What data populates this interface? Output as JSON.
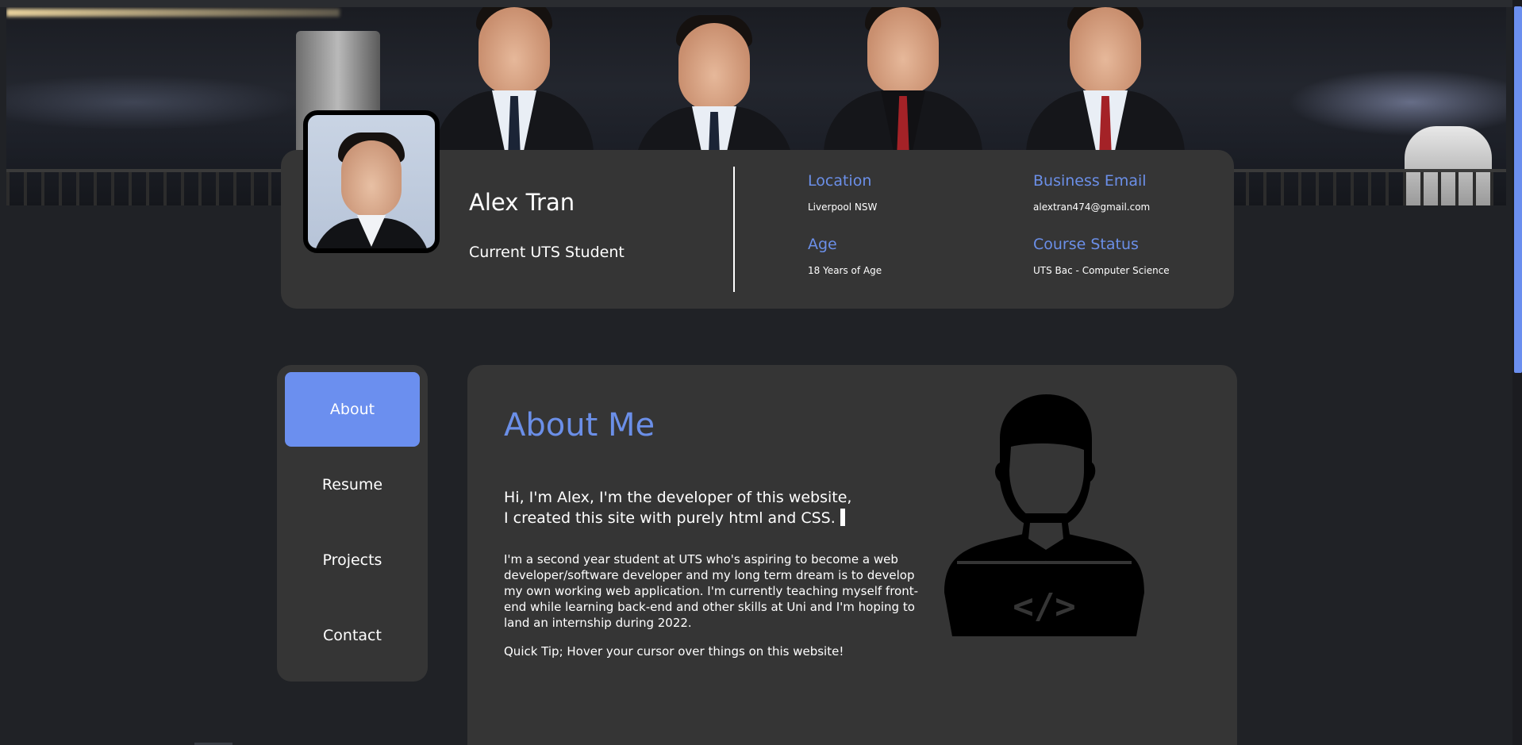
{
  "colors": {
    "background": "#202226",
    "card": "#353535",
    "accent": "#6b8fef",
    "accent_text": "#6b8fe8",
    "text": "#ffffff"
  },
  "banner": {
    "alt": "Group photo of four people at night by the water"
  },
  "profile": {
    "name": "Alex Tran",
    "subtitle": "Current UTS Student",
    "avatar_icon": "profile-photo",
    "info": [
      {
        "label": "Location",
        "value": "Liverpool NSW"
      },
      {
        "label": "Business Email",
        "value": "alextran474@gmail.com"
      },
      {
        "label": "Age",
        "value": "18 Years of Age"
      },
      {
        "label": "Course Status",
        "value": "UTS Bac - Computer Science"
      }
    ]
  },
  "nav": {
    "items": [
      {
        "label": "About",
        "active": true
      },
      {
        "label": "Resume",
        "active": false
      },
      {
        "label": "Projects",
        "active": false
      },
      {
        "label": "Contact",
        "active": false
      }
    ]
  },
  "about": {
    "title": "About Me",
    "intro_line1": "Hi, I'm Alex, I'm the developer of this website,",
    "intro_line2": "I created this site with purely html and CSS.",
    "paragraph": "I'm a second year student at UTS who's aspiring to become a web developer/software developer and my long term dream is to develop my own working web application. I'm currently teaching myself front-end while learning back-end and other skills at Uni and I'm hoping to land an internship during 2022.",
    "tip": "Quick Tip; Hover your cursor over things on this website!",
    "illustration_icon": "developer-icon",
    "illustration_code": "</>"
  }
}
